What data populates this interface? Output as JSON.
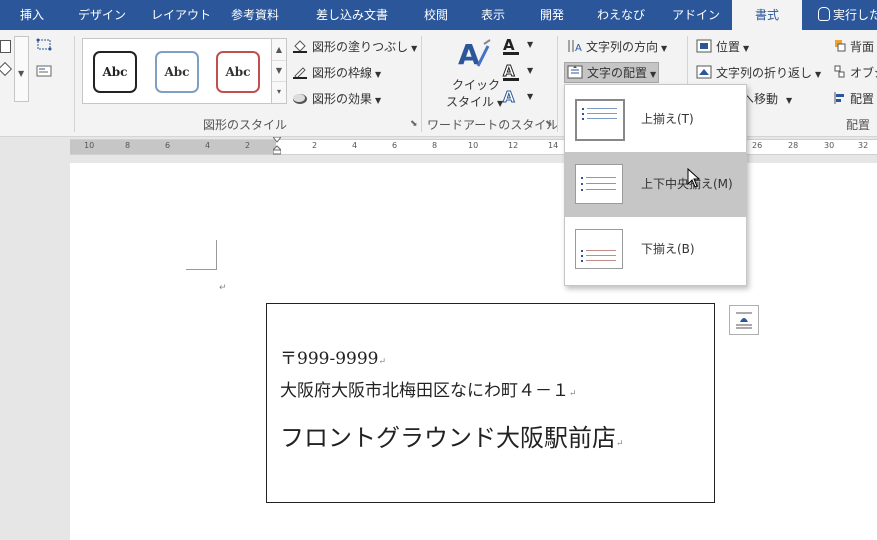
{
  "tabs": [
    {
      "label": "挿入"
    },
    {
      "label": "デザイン"
    },
    {
      "label": "レイアウト"
    },
    {
      "label": "参考資料"
    },
    {
      "label": "差し込み文書"
    },
    {
      "label": "校閲"
    },
    {
      "label": "表示"
    },
    {
      "label": "開発"
    },
    {
      "label": "わえなび"
    },
    {
      "label": "アドイン"
    },
    {
      "label": "書式"
    },
    {
      "label": "実行した"
    }
  ],
  "ribbon": {
    "shape_styles": {
      "gallery": [
        "Abc",
        "Abc",
        "Abc"
      ],
      "fill": "図形の塗りつぶし",
      "outline": "図形の枠線",
      "effects": "図形の効果",
      "group_label": "図形のスタイル"
    },
    "wordart": {
      "quick_style_line1": "クイック",
      "quick_style_line2": "スタイル",
      "group_label": "ワードアートのスタイル"
    },
    "text": {
      "direction": "文字列の方向",
      "align": "文字の配置"
    },
    "arrange": {
      "position": "位置",
      "wrap": "文字列の折り返し",
      "forward": "へ移動",
      "back": "背面",
      "object": "オブジ",
      "align": "配置",
      "group_label": "配置"
    }
  },
  "ruler": {
    "ticks": [
      "10",
      "8",
      "6",
      "4",
      "2",
      "2",
      "4",
      "6",
      "8",
      "10",
      "12",
      "14",
      "26",
      "28",
      "30",
      "32"
    ]
  },
  "dropdown": {
    "items": [
      {
        "label": "上揃え(T)"
      },
      {
        "label": "上下中央揃え(M)"
      },
      {
        "label": "下揃え(B)"
      }
    ]
  },
  "document": {
    "postal": "〒999-9999",
    "address": "大阪府大阪市北梅田区なにわ町４－１",
    "name": "フロントグラウンド大阪駅前店",
    "paragraph_mark": "↵"
  },
  "colors": {
    "accent": "#2b579a",
    "ribbon_bg": "#f3f3f3",
    "selected_item": "#c6c6c6"
  }
}
